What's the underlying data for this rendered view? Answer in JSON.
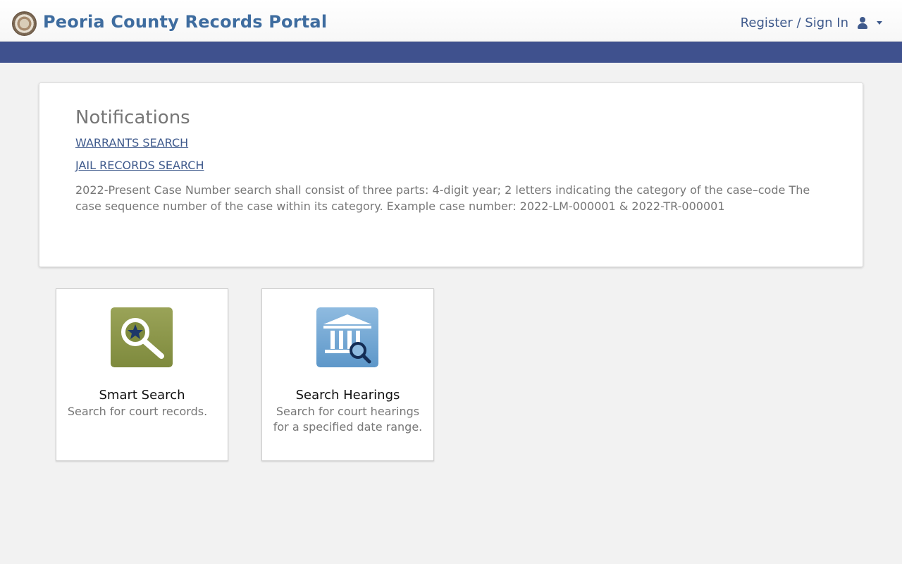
{
  "header": {
    "brand": "Peoria County Records Portal",
    "auth_label": "Register / Sign In",
    "brand_color": "#3e6c9f",
    "bar_color": "#3f518e"
  },
  "notifications": {
    "title": "Notifications",
    "links": [
      "WARRANTS SEARCH",
      "JAIL RECORDS SEARCH"
    ],
    "message": "2022-Present Case Number search shall consist of three parts: 4-digit year; 2 letters indicating the category of the case–code The case sequence number of the case within its category. Example case number: 2022-LM-000001 & 2022-TR-000001"
  },
  "tiles": [
    {
      "icon": "magnifier-star-icon",
      "title": "Smart Search",
      "description": "Search for court records."
    },
    {
      "icon": "courthouse-search-icon",
      "title": "Search Hearings",
      "description": "Search for court hearings for a specified date range."
    }
  ]
}
